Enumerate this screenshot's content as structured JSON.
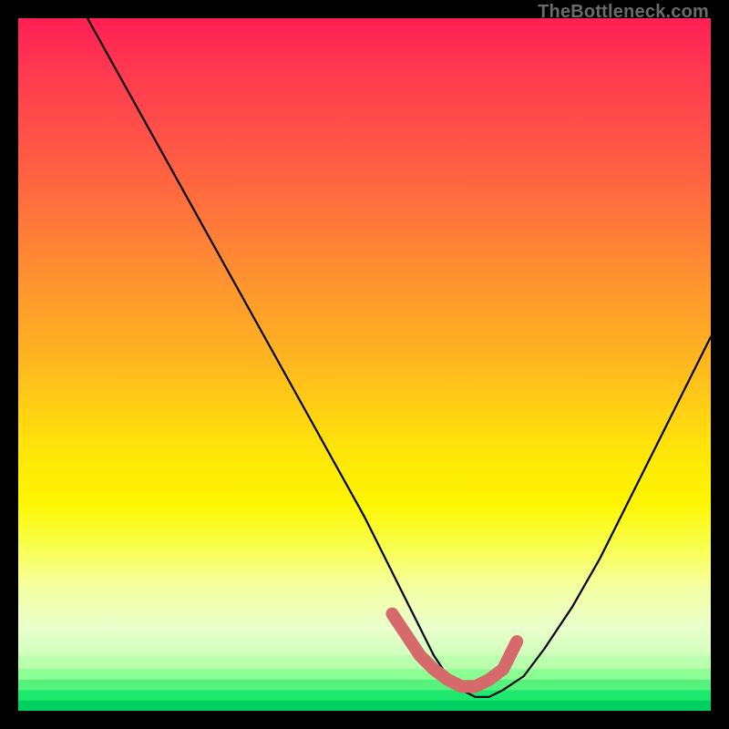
{
  "watermark": "TheBottleneck.com",
  "chart_data": {
    "type": "line",
    "title": "",
    "xlabel": "",
    "ylabel": "",
    "xlim": [
      0,
      100
    ],
    "ylim": [
      0,
      100
    ],
    "series": [
      {
        "name": "bottleneck-curve",
        "x": [
          10,
          15,
          20,
          25,
          30,
          35,
          40,
          45,
          50,
          53,
          55,
          58,
          60,
          62,
          64,
          66,
          68,
          70,
          73,
          76,
          80,
          84,
          88,
          92,
          96,
          100
        ],
        "y": [
          100,
          91,
          82,
          73,
          64,
          55,
          46,
          37,
          28,
          22,
          18,
          12,
          8,
          5,
          3,
          2,
          2,
          3,
          5,
          9,
          15,
          22,
          30,
          38,
          46,
          54
        ]
      }
    ],
    "highlight_segment": {
      "name": "optimal-zone",
      "color": "#d66a6a",
      "x": [
        54,
        56,
        58,
        60,
        62,
        64,
        66,
        68,
        70,
        71,
        72
      ],
      "y": [
        14,
        11,
        8,
        6,
        4.5,
        3.5,
        3.5,
        4.5,
        6,
        8,
        10
      ]
    },
    "gradient_stops": [
      {
        "offset": 0,
        "color": "#ff1f55"
      },
      {
        "offset": 35,
        "color": "#ff8a33"
      },
      {
        "offset": 62,
        "color": "#ffe40a"
      },
      {
        "offset": 82,
        "color": "#f4ffa0"
      },
      {
        "offset": 96,
        "color": "#8cff8c"
      },
      {
        "offset": 100,
        "color": "#00e765"
      }
    ],
    "bottom_bands": [
      {
        "y_from": 0,
        "y_to": 1.5,
        "color": "#00d060"
      },
      {
        "y_from": 1.5,
        "y_to": 3.0,
        "color": "#1fe86e"
      },
      {
        "y_from": 3.0,
        "y_to": 4.5,
        "color": "#55f37e"
      },
      {
        "y_from": 4.5,
        "y_to": 6.0,
        "color": "#8bff92"
      },
      {
        "y_from": 6.0,
        "y_to": 8.0,
        "color": "#b9ffae"
      }
    ]
  }
}
